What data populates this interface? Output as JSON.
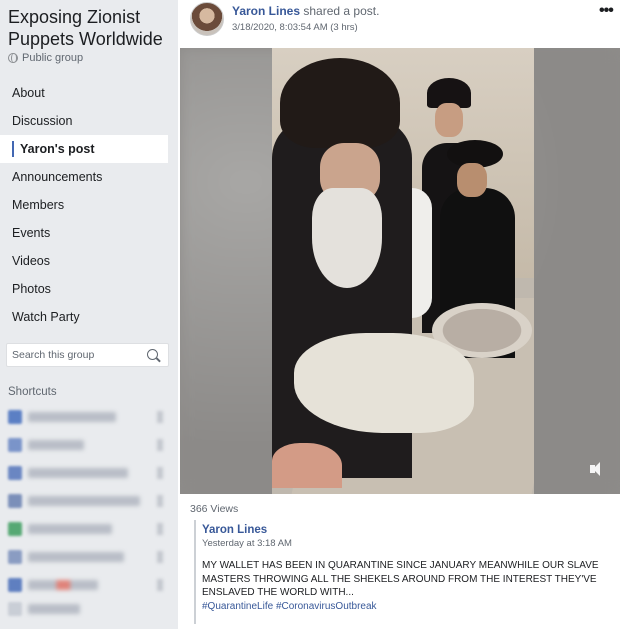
{
  "group": {
    "title": "Exposing Zionist Puppets Worldwide",
    "privacy": "Public group"
  },
  "nav": [
    {
      "label": "About"
    },
    {
      "label": "Discussion"
    },
    {
      "label": "Yaron's post",
      "active": true
    },
    {
      "label": "Announcements"
    },
    {
      "label": "Members"
    },
    {
      "label": "Events"
    },
    {
      "label": "Videos"
    },
    {
      "label": "Photos"
    },
    {
      "label": "Watch Party"
    }
  ],
  "search": {
    "placeholder": "Search this group"
  },
  "shortcuts": {
    "label": "Shortcuts"
  },
  "post": {
    "author": "Yaron Lines",
    "action": "shared a post.",
    "timestamp": "3/18/2020, 8:03:54 AM (3 hrs)",
    "views": "366 Views",
    "shared_post": {
      "author": "Yaron Lines",
      "time": "Yesterday at 3:18 AM",
      "text": "MY WALLET HAS BEEN IN QUARANTINE SINCE JANUARY MEANWHILE OUR SLAVE MASTERS THROWING ALL THE SHEKELS AROUND FROM THE INTEREST THEY'VE ENSLAVED THE WORLD WITH...",
      "hashtags": "#QuarantineLife #CoronavirusOutbreak"
    }
  },
  "colors": {
    "sidebar_bg": "#e9ebee",
    "link": "#385898",
    "accent": "#4267b2"
  }
}
